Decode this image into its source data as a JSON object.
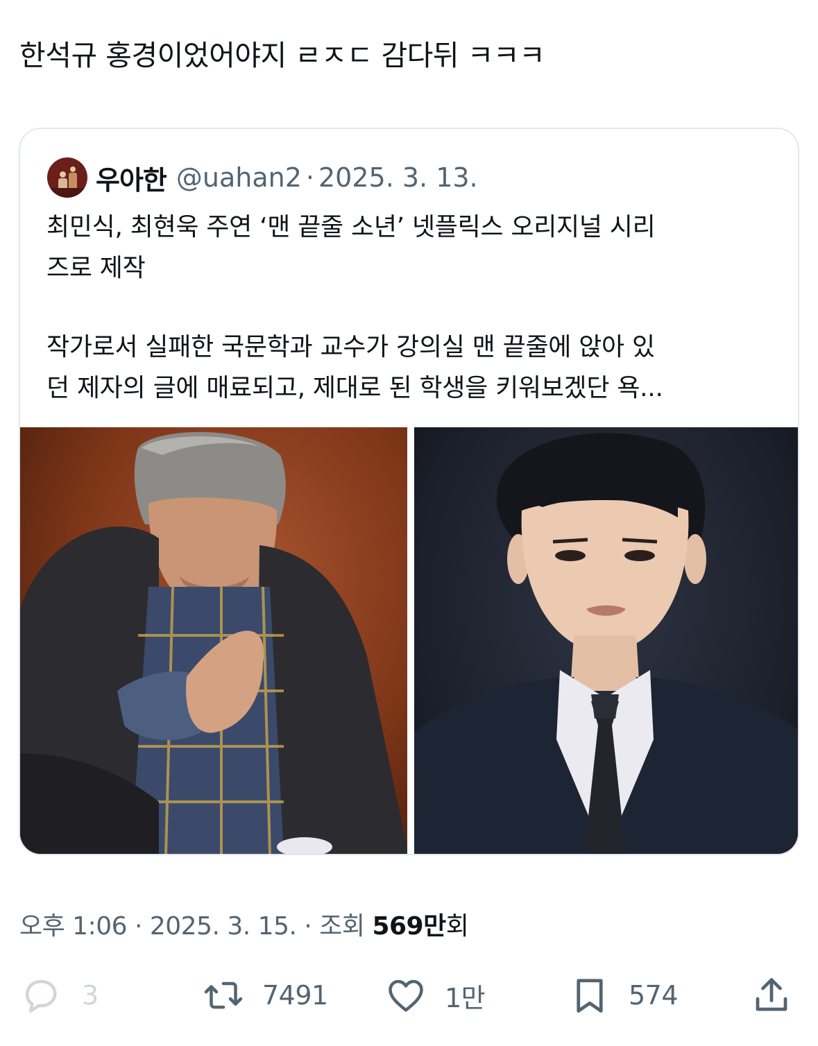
{
  "tweet": {
    "text": "한석규 홍경이었어야지 ㄹㅈㄷ 감다뒤 ㅋㅋㅋ"
  },
  "quote": {
    "name": "우아한",
    "handle": "@uahan2",
    "separator": "·",
    "date": "2025. 3. 13.",
    "line1": "최민식, 최현욱 주연 ‘맨 끝줄 소년’ 넷플릭스 오리지널 시리",
    "line2": "즈로 제작",
    "line3": "작가로서 실패한 국문학과 교수가 강의실 맨 끝줄에 앉아 있",
    "line4": "던 제자의 글에 매료되고, 제대로 된 학생을 키워보겠단 욕..."
  },
  "meta": {
    "time": "오후 1:06",
    "sep1": " · ",
    "date": "2025. 3. 15.",
    "sep2": " · ",
    "views_label": "조회 ",
    "views_number": "569",
    "views_unit_man": "만",
    "views_unit_hoe": "회"
  },
  "actions": {
    "reply_count": "3",
    "retweet_count": "7491",
    "like_count": "1만",
    "bookmark_count": "574"
  },
  "icons": {
    "reply": "reply-icon",
    "retweet": "retweet-icon",
    "like": "heart-icon",
    "bookmark": "bookmark-icon",
    "share": "share-icon"
  },
  "colors": {
    "text_primary": "#0f1419",
    "text_secondary": "#536471",
    "border": "#e3e7ea",
    "reply_muted": "#d0d6db"
  }
}
